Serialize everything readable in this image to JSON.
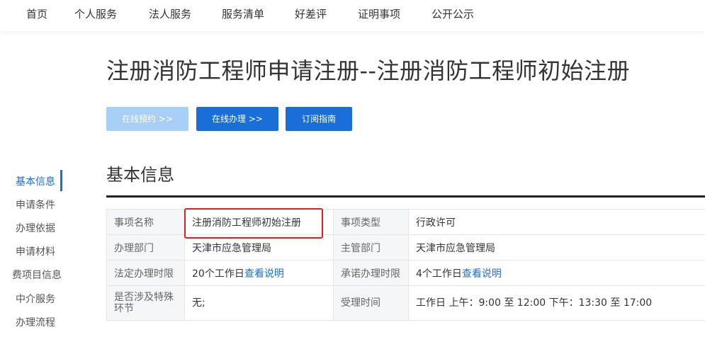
{
  "nav": {
    "items": [
      "首页",
      "个人服务",
      "法人服务",
      "服务清单",
      "好差评",
      "证明事项",
      "公开公示"
    ]
  },
  "page": {
    "title": "注册消防工程师申请注册--注册消防工程师初始注册"
  },
  "actions": {
    "booking": "在线预约 >>",
    "online": "在线办理 >>",
    "subscribe": "订阅指南"
  },
  "sidebar": {
    "items": [
      "基本信息",
      "申请条件",
      "办理依据",
      "申请材料",
      "费项目信息",
      "中介服务",
      "办理流程"
    ]
  },
  "section": {
    "title": "基本信息"
  },
  "info": {
    "r1": {
      "l1": "事项名称",
      "v1": "注册消防工程师初始注册",
      "l2": "事项类型",
      "v2": "行政许可"
    },
    "r2": {
      "l1": "办理部门",
      "v1": "天津市应急管理局",
      "l2": "主管部门",
      "v2": "天津市应急管理局"
    },
    "r3": {
      "l1": "法定办理时限",
      "v1": "20个工作日",
      "v1_link": "查看说明",
      "l2": "承诺办理时限",
      "v2": "4个工作日",
      "v2_link": "查看说明"
    },
    "r4": {
      "l1": "是否涉及特殊环节",
      "v1": "无;",
      "l2": "受理时间",
      "v2": "工作日 上午：9:00 至 12:00 下午：13:30 至 17:00"
    }
  },
  "colors": {
    "accent": "#1a6ed8",
    "disabled": "#a8cff5",
    "highlight": "#e02020"
  }
}
